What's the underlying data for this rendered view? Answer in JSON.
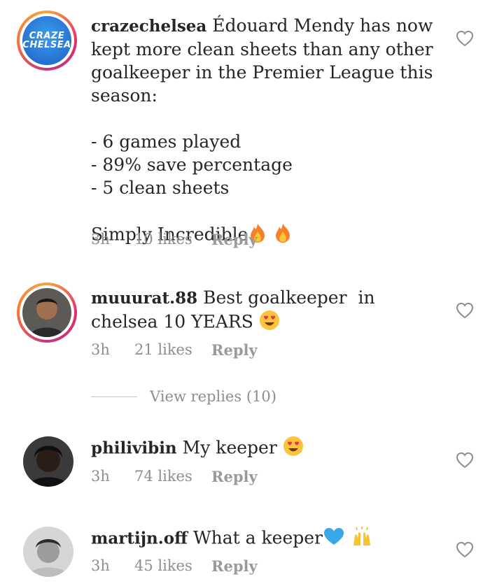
{
  "comments": [
    {
      "username": "crazechelsea",
      "avatar_text": [
        "CRAZE",
        "CHELSEA"
      ],
      "text": "Édouard Mendy has now kept more clean sheets than any other goalkeeper in the Premier League this season:\n\n- 6 games played\n- 89% save percentage\n- 5 clean sheets\n\nSimply Incredible",
      "emoji": [
        "fire",
        "fire"
      ],
      "time": "3h",
      "likes": "10 likes",
      "reply": "Reply"
    },
    {
      "username": "muuurat.88",
      "text": "Best goalkeeper  in chelsea 10 YEARS",
      "emoji": [
        "heart-eyes"
      ],
      "time": "3h",
      "likes": "21 likes",
      "reply": "Reply"
    },
    {
      "username": "philivibin",
      "text": "My keeper",
      "emoji": [
        "heart-eyes"
      ],
      "time": "3h",
      "likes": "74 likes",
      "reply": "Reply"
    },
    {
      "username": "martijn.off",
      "text": "What a keeper",
      "emoji": [
        "blue-heart",
        "raised-hands"
      ],
      "time": "3h",
      "likes": "45 likes",
      "reply": "Reply"
    }
  ],
  "view_replies": "View replies (10)",
  "colors": {
    "meta": "#8e8e8e",
    "text": "#262626",
    "ring": "#e1306c"
  }
}
